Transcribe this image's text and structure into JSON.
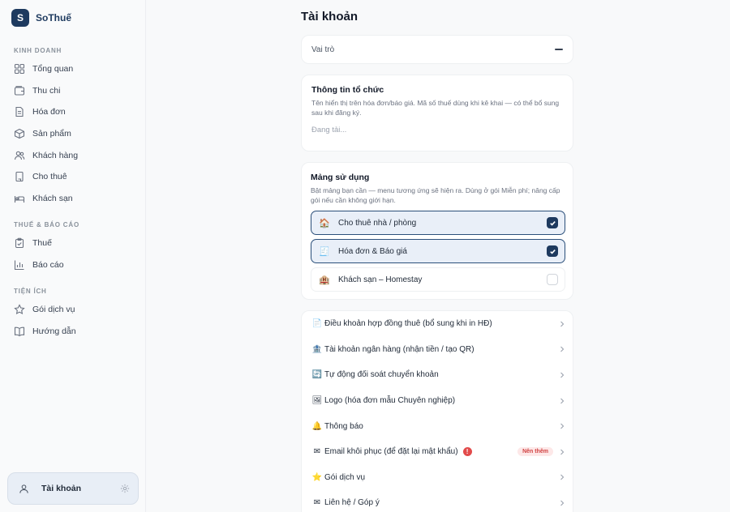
{
  "brand": {
    "logo_letter": "S",
    "name": "SoThuế"
  },
  "sidebar": {
    "sections": [
      {
        "title": "KINH DOANH",
        "items": [
          {
            "label": "Tổng quan",
            "icon": "grid-icon"
          },
          {
            "label": "Thu chi",
            "icon": "wallet-icon"
          },
          {
            "label": "Hóa đơn",
            "icon": "document-icon"
          },
          {
            "label": "Sản phẩm",
            "icon": "box-icon"
          },
          {
            "label": "Khách hàng",
            "icon": "users-icon"
          },
          {
            "label": "Cho thuê",
            "icon": "building-icon"
          },
          {
            "label": "Khách sạn",
            "icon": "bed-icon"
          }
        ]
      },
      {
        "title": "THUẾ & BÁO CÁO",
        "items": [
          {
            "label": "Thuế",
            "icon": "clipboard-icon"
          },
          {
            "label": "Báo cáo",
            "icon": "bar-chart-icon"
          }
        ]
      },
      {
        "title": "TIỆN ÍCH",
        "items": [
          {
            "label": "Gói dịch vụ",
            "icon": "star-icon"
          },
          {
            "label": "Hướng dẫn",
            "icon": "book-icon"
          }
        ]
      }
    ],
    "account": {
      "label": "Tài khoản",
      "icon": "user-icon"
    }
  },
  "main": {
    "title": "Tài khoản",
    "role": {
      "label": "Vai trò"
    },
    "org": {
      "title": "Thông tin tổ chức",
      "desc": "Tên hiển thị trên hóa đơn/báo giá. Mã số thuế dùng khi kê khai — có thể bổ sung sau khi đăng ký.",
      "loading": "Đang tải..."
    },
    "modules": {
      "title": "Mảng sử dụng",
      "desc": "Bật mảng bạn cần — menu tương ứng sẽ hiện ra. Dùng ở gói Miễn phí; nâng cấp gói nếu cần không giới hạn.",
      "options": [
        {
          "emoji": "🏠",
          "label": "Cho thuê nhà / phòng",
          "checked": true
        },
        {
          "emoji": "🧾",
          "label": "Hóa đơn & Báo giá",
          "checked": true
        },
        {
          "emoji": "🏨",
          "label": "Khách sạn – Homestay",
          "checked": false
        }
      ]
    },
    "settings": [
      {
        "emoji": "📄",
        "label": "Điều khoản hợp đồng thuê (bổ sung khi in HĐ)"
      },
      {
        "emoji": "🏦",
        "label": "Tài khoản ngân hàng (nhận tiền / tạo QR)"
      },
      {
        "emoji": "🔄",
        "label": "Tự động đối soát chuyển khoản"
      },
      {
        "emoji": "🖼",
        "label": "Logo (hóa đơn mẫu Chuyên nghiệp)"
      },
      {
        "emoji": "🔔",
        "label": "Thông báo"
      },
      {
        "emoji": "✉",
        "label": "Email khôi phục (để đặt lại mật khẩu)",
        "alert": "!",
        "badge": "Nên thêm"
      },
      {
        "emoji": "⭐",
        "label": "Gói dịch vụ"
      },
      {
        "emoji": "✉",
        "label": "Liên hệ / Góp ý"
      }
    ]
  }
}
